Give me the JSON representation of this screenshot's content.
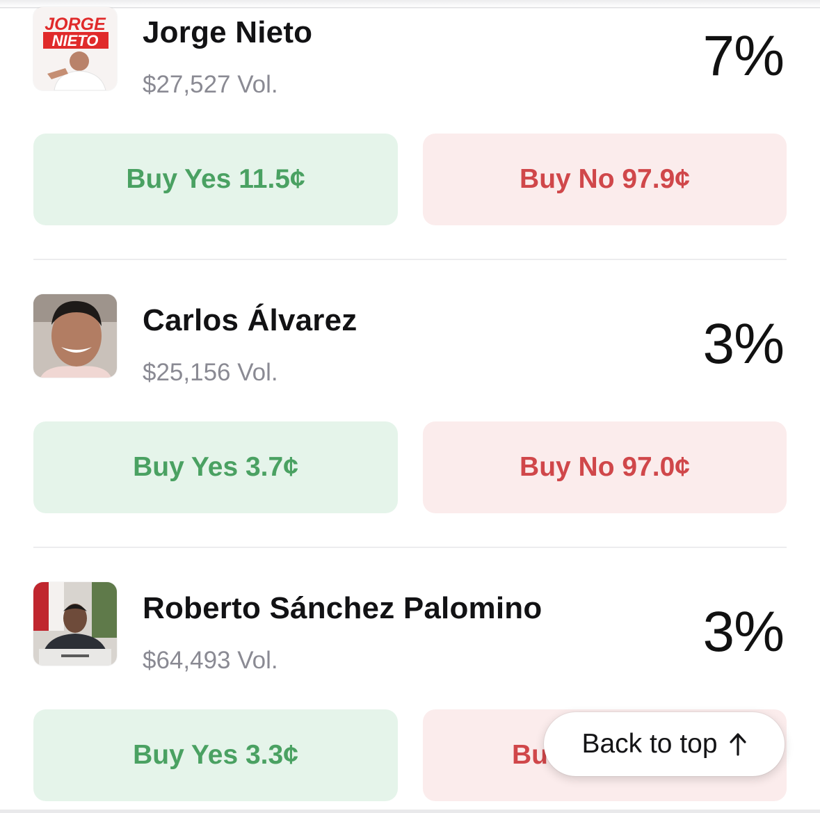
{
  "candidates": [
    {
      "name": "Jorge Nieto",
      "volume": "$27,527 Vol.",
      "percent": "7%",
      "buy_yes": "Buy Yes 11.5¢",
      "buy_no": "Buy No 97.9¢",
      "logo_text": [
        "JORGE",
        "NIETO"
      ]
    },
    {
      "name": "Carlos Álvarez",
      "volume": "$25,156 Vol.",
      "percent": "3%",
      "buy_yes": "Buy Yes 3.7¢",
      "buy_no": "Buy No 97.0¢"
    },
    {
      "name": "Roberto Sánchez Palomino",
      "volume": "$64,493 Vol.",
      "percent": "3%",
      "buy_yes": "Buy Yes 3.3¢",
      "buy_no": "Bu"
    }
  ],
  "back_to_top": {
    "label": "Back to top",
    "icon": "arrow-up-icon"
  },
  "colors": {
    "yes_bg": "#e5f4ea",
    "yes_text": "#4aa162",
    "no_bg": "#fbecec",
    "no_text": "#d0474a",
    "volume_text": "#8a8a93"
  }
}
